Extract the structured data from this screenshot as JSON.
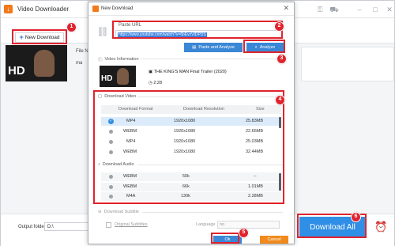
{
  "app": {
    "title": "Video Downloader",
    "new_download_label": "New Download",
    "file_name_label": "File Na",
    "bg_row_text": "ma",
    "output_folder_label": "Output folder:",
    "output_folder_value": "D:\\",
    "download_all_label": "Download All",
    "thumb_badge": "HD"
  },
  "dialog": {
    "title": "New Download",
    "paste_url_label": "Paste URL",
    "url_value": "https://www.youtube.com/watch?v=6bEvzVIDPDS",
    "paste_and_analyze_label": "Paste and Analyze",
    "analyze_label": "Analyze",
    "video_info_label": "Video Information",
    "video_title": "THE KING'S MAN Final Trailer (2020)",
    "duration": "2:28",
    "thumb_badge": "HD",
    "download_video_label": "Download Video",
    "video_columns": [
      "Download Format",
      "Download Resolution",
      "Size"
    ],
    "video_rows": [
      {
        "format": "MP4",
        "resolution": "1920x1080",
        "size": "25.83MB",
        "selected": true
      },
      {
        "format": "WEBM",
        "resolution": "1920x1080",
        "size": "22.66MB",
        "selected": false
      },
      {
        "format": "MP4",
        "resolution": "1920x1080",
        "size": "25.03MB",
        "selected": false
      },
      {
        "format": "WEBM",
        "resolution": "1920x1080",
        "size": "32.44MB",
        "selected": false
      }
    ],
    "download_audio_label": "Download Audio",
    "audio_rows": [
      {
        "format": "WEBM",
        "bitrate": "50k",
        "size": "--"
      },
      {
        "format": "WEBM",
        "bitrate": "66k",
        "size": "1.01MB"
      },
      {
        "format": "M4A",
        "bitrate": "130k",
        "size": "2.28MB"
      }
    ],
    "download_subtitle_label": "Download Subtitle",
    "original_subtitles_label": "Original Subtitles",
    "language_label": "Language",
    "language_value": "no",
    "ok_label": "Ok",
    "cancel_label": "Cancel"
  },
  "callouts": [
    "1",
    "2",
    "3",
    "4",
    "5",
    "6"
  ],
  "colors": {
    "accent_blue": "#2f8ee5",
    "accent_orange": "#f08a1c",
    "highlight_red": "#e0232d"
  }
}
